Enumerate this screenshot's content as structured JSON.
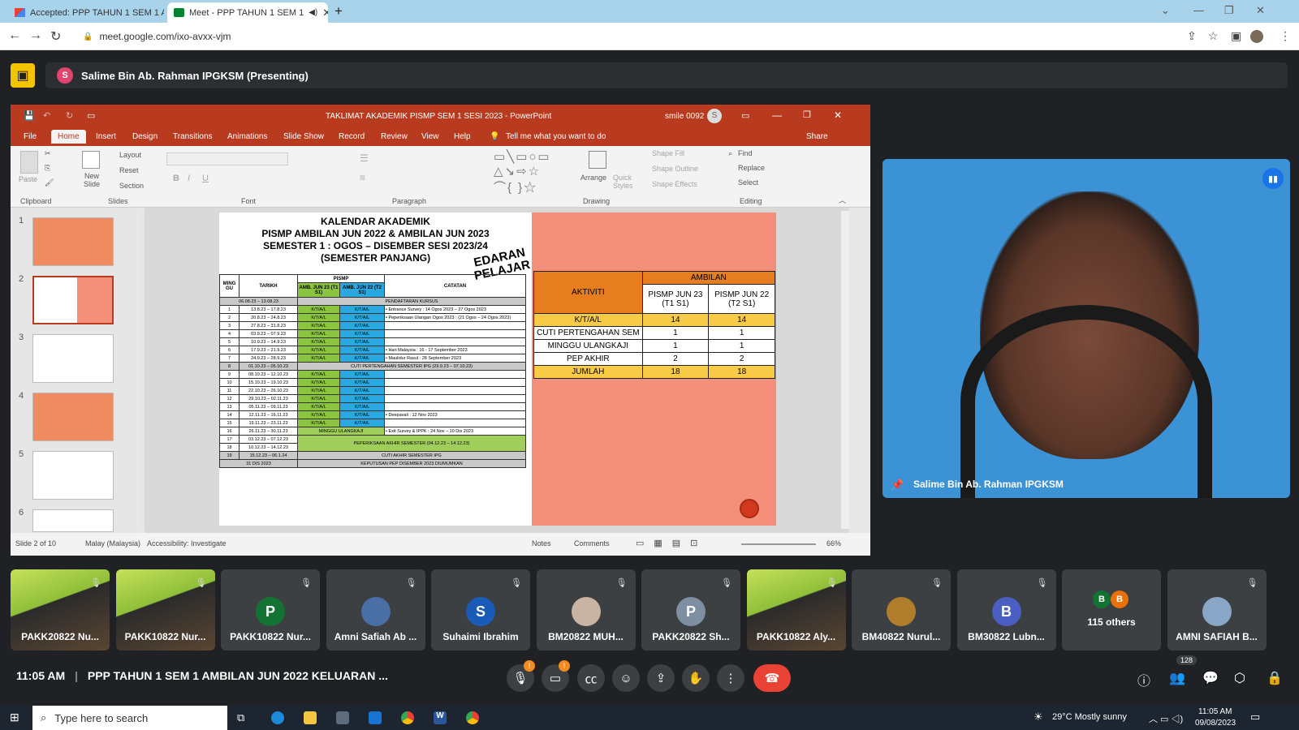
{
  "browser": {
    "tabs": [
      {
        "title": "Accepted: PPP TAHUN 1 SEM 1 A",
        "icon": "gmail-icon"
      },
      {
        "title": "Meet - PPP TAHUN 1 SEM 1",
        "icon": "meet-icon"
      }
    ],
    "url": "meet.google.com/ixo-avxx-vjm"
  },
  "presenting": {
    "avatar_letter": "S",
    "label": "Salime Bin Ab. Rahman IPGKSM (Presenting)"
  },
  "ppt": {
    "title": "TAKLIMAT AKADEMIK PISMP SEM 1 SESI 2023 - PowerPoint",
    "user": "smile 0092",
    "user_initial": "S",
    "tabs": [
      "File",
      "Home",
      "Insert",
      "Design",
      "Transitions",
      "Animations",
      "Slide Show",
      "Record",
      "Review",
      "View",
      "Help"
    ],
    "tell_me": "Tell me what you want to do",
    "share": "Share",
    "ribbon": {
      "paste": "Paste",
      "new_slide": "New Slide",
      "layout": "Layout",
      "reset": "Reset",
      "section": "Section",
      "find": "Find",
      "replace": "Replace",
      "select": "Select",
      "arrange": "Arrange",
      "quick_styles": "Quick Styles",
      "shape_fill": "Shape Fill",
      "shape_outline": "Shape Outline",
      "shape_effects": "Shape Effects",
      "groups": [
        "Clipboard",
        "Slides",
        "Font",
        "Paragraph",
        "Drawing",
        "Editing"
      ]
    },
    "thumb_numbers": [
      "1",
      "2",
      "3",
      "4",
      "5",
      "6"
    ],
    "status": {
      "slide": "Slide 2 of 10",
      "language": "Malay (Malaysia)",
      "accessibility": "Accessibility: Investigate",
      "notes": "Notes",
      "comments": "Comments",
      "zoom": "66%"
    }
  },
  "slide": {
    "title_lines": [
      "KALENDAR AKADEMIK",
      "PISMP AMBILAN JUN 2022 & AMBILAN JUN 2023",
      "SEMESTER 1 : OGOS – DISEMBER SESI 2023/24",
      "(SEMESTER PANJANG)"
    ],
    "stamp": [
      "EDARAN",
      "PELAJAR"
    ],
    "cal_headers": {
      "week": "MING GU",
      "date": "TARIKH",
      "pismp": "PISMP",
      "amb23": "AMB. JUN 23 (T1 S1)",
      "amb22": "AMB. JUN 22 (T2 S1)",
      "notes": "CATATAN"
    },
    "pendaftaran": {
      "date": "06.08.23 – 13.08.23",
      "label": "PENDAFTARAN KURSUS"
    },
    "rows": [
      {
        "w": "1",
        "d": "13.8.23 – 17.8.23",
        "a": "K/T/A/L",
        "b": "K/T/A/L",
        "n": "• Entrance Survey : 14 Ogos 2023 – 27 Ogos 2023"
      },
      {
        "w": "2",
        "d": "20.8.23 – 24.8.23",
        "a": "K/T/A/L",
        "b": "K/T/A/L",
        "n": "• Peperiksaan Ulangan Ogos 2023 : (21 Ogos – 24 Ogos 2023)"
      },
      {
        "w": "3",
        "d": "27.8.23 – 31.8.23",
        "a": "K/T/A/L",
        "b": "K/T/A/L",
        "n": ""
      },
      {
        "w": "4",
        "d": "03.9.23 – 07.9.23",
        "a": "K/T/A/L",
        "b": "K/T/A/L",
        "n": ""
      },
      {
        "w": "5",
        "d": "10.9.23 – 14.9.23",
        "a": "K/T/A/L",
        "b": "K/T/A/L",
        "n": ""
      },
      {
        "w": "6",
        "d": "17.9.23 – 21.9.23",
        "a": "K/T/A/L",
        "b": "K/T/A/L",
        "n": "• Hari Malaysia : 16 - 17 September 2023"
      },
      {
        "w": "7",
        "d": "24.9.23 – 28.9.23",
        "a": "K/T/A/L",
        "b": "K/T/A/L",
        "n": "• Maulidur Rasul : 28 September 2023"
      }
    ],
    "cuti_row": {
      "w": "8",
      "d": "01.10.23 – 05.10.23",
      "label": "CUTI PERTENGAHAN SEMESTER IPG (29.9.23 – 07.10.23)"
    },
    "rows2": [
      {
        "w": "9",
        "d": "08.10.23 – 12.10.23",
        "a": "K/T/A/L",
        "b": "K/T/A/L",
        "n": ""
      },
      {
        "w": "10",
        "d": "15.10.23 – 19.10.23",
        "a": "K/T/A/L",
        "b": "K/T/A/L",
        "n": ""
      },
      {
        "w": "11",
        "d": "22.10.23 – 26.10.23",
        "a": "K/T/A/L",
        "b": "K/T/A/L",
        "n": ""
      },
      {
        "w": "12",
        "d": "29.10.23 – 02.11.23",
        "a": "K/T/A/L",
        "b": "K/T/A/L",
        "n": ""
      },
      {
        "w": "13",
        "d": "05.11.23 – 09.11.23",
        "a": "K/T/A/L",
        "b": "K/T/A/L",
        "n": ""
      },
      {
        "w": "14",
        "d": "12.11.23 – 16.11.23",
        "a": "K/T/A/L",
        "b": "K/T/A/L",
        "n": "• Deepavali : 12 Nov 2023"
      },
      {
        "w": "15",
        "d": "19.11.23 – 23.11.23",
        "a": "K/T/A/L",
        "b": "K/T/A/L",
        "n": ""
      }
    ],
    "row16": {
      "w": "16",
      "d": "26.11.23 – 30.11.23",
      "label": "MINGGU ULANGKAJI",
      "n": "• Exit Survey & IPPK : 24 Nov – 10 Dis 2023"
    },
    "row17": {
      "w": "17",
      "d": "03.12.23 – 07.12.23"
    },
    "row18": {
      "w": "18",
      "d": "10.12.23 – 14.12.23",
      "label": "PEPERIKSAAN AKHIR SEMESTER (04.12.23 – 14.12.23)"
    },
    "row19": {
      "w": "19",
      "d": "15.12.23 – 06.1.24",
      "label": "CUTI AKHIR SEMESTER IPG"
    },
    "row_last": {
      "d": "31 DIS 2023",
      "label": "KEPUTUSAN PEP DISEMBER 2023 DIUMUMKAN"
    },
    "amb_table": {
      "header": "AMBILAN",
      "aktiviti": "AKTIVITI",
      "col1": "PISMP JUN 23 (T1 S1)",
      "col2": "PISMP JUN 22 (T2 S1)",
      "rows": [
        {
          "label": "K/T/A/L",
          "a": "14",
          "b": "14"
        },
        {
          "label": "CUTI PERTENGAHAN SEM",
          "a": "1",
          "b": "1"
        },
        {
          "label": "MINGGU ULANGKAJI",
          "a": "1",
          "b": "1"
        },
        {
          "label": "PEP AKHIR",
          "a": "2",
          "b": "2"
        }
      ],
      "total": {
        "label": "JUMLAH",
        "a": "18",
        "b": "18"
      }
    }
  },
  "video": {
    "name": "Salime Bin Ab. Rahman IPGKSM"
  },
  "participants": [
    {
      "name": "PAKK20822 Nu...",
      "type": "photo"
    },
    {
      "name": "PAKK10822 Nur...",
      "type": "photo"
    },
    {
      "name": "PAKK10822 Nur...",
      "type": "letter",
      "letter": "P",
      "color": "#137333"
    },
    {
      "name": "Amni Safiah Ab ...",
      "type": "pic",
      "color": "#4a6fa5"
    },
    {
      "name": "Suhaimi Ibrahim",
      "type": "letter",
      "letter": "S",
      "color": "#1a5bb8"
    },
    {
      "name": "BM20822 MUH...",
      "type": "pic",
      "color": "#c9b3a3"
    },
    {
      "name": "PAKK20822 Sh...",
      "type": "letter",
      "letter": "P",
      "color": "#7d8fa0"
    },
    {
      "name": "PAKK10822 Aly...",
      "type": "photo"
    },
    {
      "name": "BM40822 Nurul...",
      "type": "pic",
      "color": "#b07d2a"
    },
    {
      "name": "BM30822 Lubn...",
      "type": "letter",
      "letter": "B",
      "color": "#4b5fc2"
    },
    {
      "name": "115 others",
      "type": "others"
    },
    {
      "name": "AMNI SAFIAH B...",
      "type": "pic",
      "color": "#8aa6c7"
    }
  ],
  "others_letters": [
    "B",
    "B"
  ],
  "bottom": {
    "time": "11:05 AM",
    "meeting": "PPP TAHUN 1 SEM 1 AMBILAN JUN 2022 KELUARAN ...",
    "people_count": "128"
  },
  "taskbar": {
    "search": "Type here to search",
    "weather": "29°C  Mostly sunny",
    "time": "11:05 AM",
    "date": "09/08/2023"
  }
}
